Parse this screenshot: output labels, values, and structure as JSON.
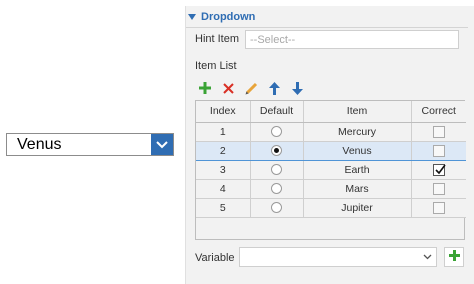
{
  "preview": {
    "selected_value": "Venus"
  },
  "panel": {
    "section_title": "Dropdown",
    "hint": {
      "label": "Hint Item",
      "placeholder": "--Select--",
      "value": ""
    },
    "item_list_label": "Item List",
    "toolbar": {
      "add_icon": "plus-icon",
      "delete_icon": "x-icon",
      "edit_icon": "pencil-icon",
      "up_icon": "arrow-up-icon",
      "down_icon": "arrow-down-icon"
    },
    "table": {
      "headers": [
        "Index",
        "Default",
        "Item",
        "Correct"
      ],
      "rows": [
        {
          "index": "1",
          "default": false,
          "item": "Mercury",
          "correct": false
        },
        {
          "index": "2",
          "default": true,
          "item": "Venus",
          "correct": false
        },
        {
          "index": "3",
          "default": false,
          "item": "Earth",
          "correct": true
        },
        {
          "index": "4",
          "default": false,
          "item": "Mars",
          "correct": false
        },
        {
          "index": "5",
          "default": false,
          "item": "Jupiter",
          "correct": false
        }
      ],
      "selected_row": 1
    },
    "variable": {
      "label": "Variable",
      "value": ""
    }
  },
  "colors": {
    "accent": "#2f6db3",
    "add_green": "#3aa335",
    "delete_red": "#d93025",
    "selected_row": "#dce8f6"
  }
}
